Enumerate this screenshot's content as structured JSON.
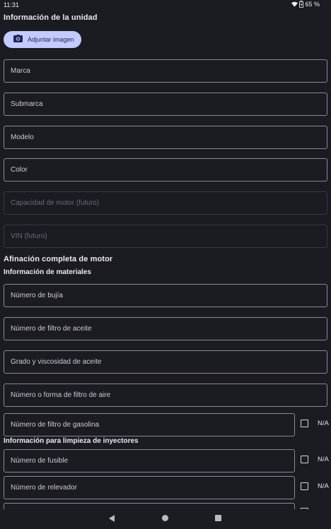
{
  "status": {
    "time": "11:31",
    "battery": "65 %"
  },
  "unit_info": {
    "title": "Información de la unidad",
    "attach_label": "Adjuntar imagen",
    "fields": {
      "brand": "Marca",
      "sub_brand": "Submarca",
      "model": "Modelo",
      "color": "Color",
      "engine_capacity": "Capacidad de motor (futuro)",
      "vin": "VIN (futuro)"
    }
  },
  "tuneup": {
    "title": "Afinación completa de motor",
    "materials_title": "Información de materiales",
    "fields": {
      "spark_plug": "Número de bujía",
      "oil_filter": "Número de filtro de aceite",
      "oil_grade": "Grado y viscosidad de aceite",
      "air_filter": "Número o forma de filtro de aire",
      "fuel_filter": "Número de filtro de gasolina"
    },
    "na_label": "N/A"
  },
  "injectors": {
    "title": "Información para limpieza de inyectores",
    "fields": {
      "fuse": "Número de fusible",
      "relay": "Número de relevador"
    }
  },
  "colors": {
    "accent": "#c4cbff",
    "background": "#1b1b22",
    "outline": "#8c8894"
  },
  "icons": {
    "camera": "camera-icon",
    "wifi": "wifi-icon",
    "battery": "battery-icon"
  }
}
